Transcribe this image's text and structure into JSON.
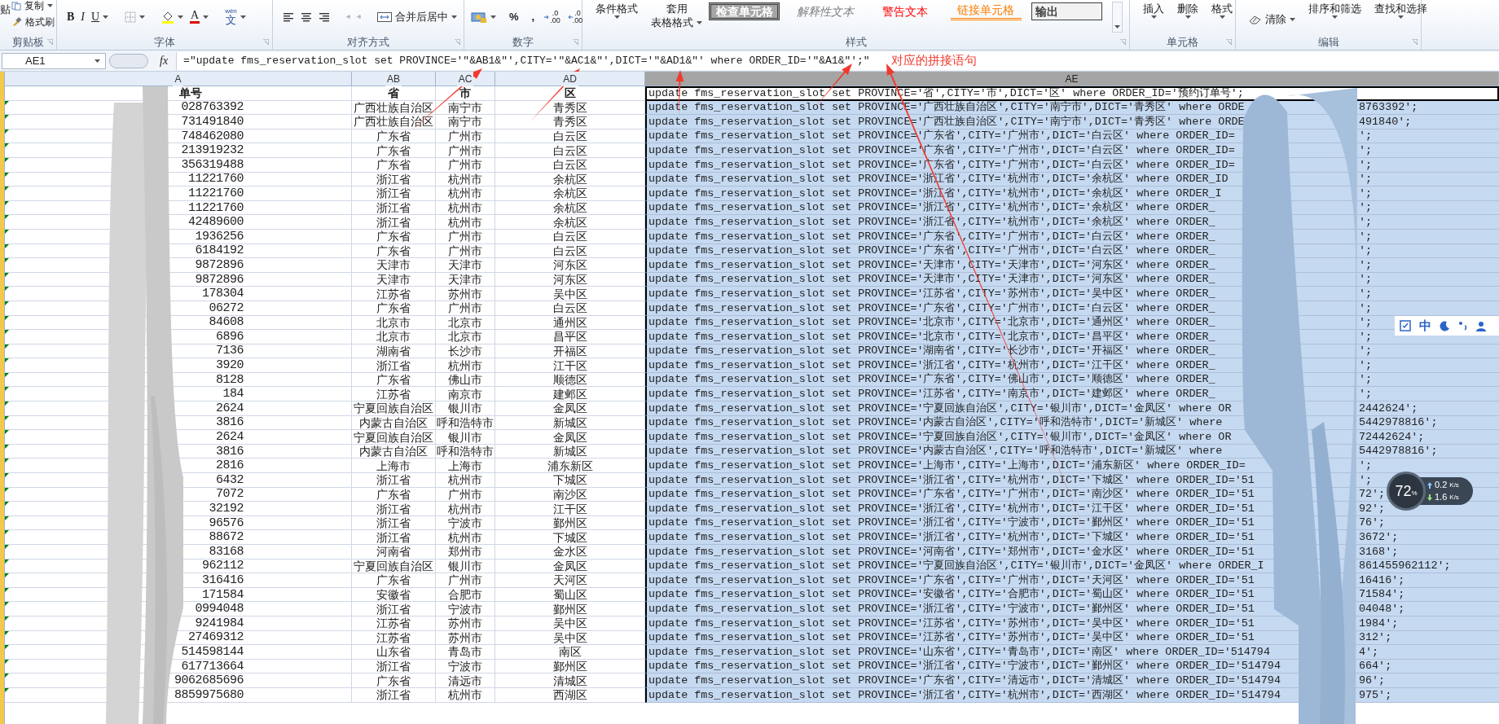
{
  "ribbon": {
    "groups": [
      {
        "label": "剪贴板",
        "items": [
          {
            "kind": "paste",
            "text": "贴"
          },
          {
            "kind": "copy",
            "text": "复制"
          },
          {
            "kind": "brush",
            "text": "格式刷"
          }
        ]
      },
      {
        "label": "字体",
        "items": [
          {
            "kind": "bold",
            "text": "B"
          },
          {
            "kind": "italic",
            "text": "I"
          },
          {
            "kind": "underline",
            "text": "U"
          },
          {
            "kind": "border"
          },
          {
            "kind": "fill"
          },
          {
            "kind": "fontcolor",
            "text": "A"
          },
          {
            "kind": "phonetic",
            "text": "文",
            "sup": "wén"
          }
        ]
      },
      {
        "label": "对齐方式",
        "items": [
          {
            "kind": "alignleft"
          },
          {
            "kind": "aligncenter"
          },
          {
            "kind": "alignright"
          },
          {
            "kind": "outdent"
          },
          {
            "kind": "indent"
          },
          {
            "kind": "merge",
            "text": "合并后居中"
          }
        ]
      },
      {
        "label": "数字",
        "items": [
          {
            "kind": "currency"
          },
          {
            "kind": "plain",
            "text": "%"
          },
          {
            "kind": "plain",
            "text": ","
          },
          {
            "kind": "decinc",
            "text": ".00",
            "sup": ".0"
          },
          {
            "kind": "decdec",
            "text": ".00",
            "sup": ".0"
          }
        ]
      },
      {
        "label": "样式",
        "items": [
          {
            "kind": "stacked",
            "text": "条件格式"
          },
          {
            "kind": "stacked",
            "text": "套用",
            "sub": "表格格式"
          },
          {
            "kind": "check",
            "text": "检查单元格"
          },
          {
            "kind": "explain",
            "text": "解释性文本"
          },
          {
            "kind": "warn",
            "text": "警告文本"
          },
          {
            "kind": "link",
            "text": "链接单元格"
          },
          {
            "kind": "output",
            "text": "输出"
          },
          {
            "kind": "gallery"
          }
        ]
      },
      {
        "label": "单元格",
        "items": [
          {
            "kind": "stacked",
            "text": "插入"
          },
          {
            "kind": "stacked",
            "text": "删除"
          },
          {
            "kind": "stacked",
            "text": "格式"
          }
        ]
      },
      {
        "label": "编辑",
        "items": [
          {
            "kind": "clear",
            "text": "清除"
          },
          {
            "kind": "stacked",
            "text": "排序和筛选"
          },
          {
            "kind": "stacked",
            "text": "查找和选择"
          }
        ]
      }
    ]
  },
  "name_box": "AE1",
  "fx": "fx",
  "formula": "=\"update fms_reservation_slot set PROVINCE='\"&AB1&\"',CITY='\"&AC1&\"',DICT='\"&AD1&\"' where ORDER_ID='\"&A1&\"';\"",
  "annotation": "对应的拼接语句",
  "columns": [
    "A",
    "AB",
    "AC",
    "AD",
    "AE"
  ],
  "header": {
    "a": "单号",
    "province": "省",
    "city": "市",
    "district": "区",
    "sql": "update fms_reservation_slot set PROVINCE='省',CITY='市',DICT='区' where ORDER_ID='预约订单号';"
  },
  "rows": [
    {
      "order": "028763392",
      "province": "广西壮族自治区",
      "city": "南宁市",
      "district": "青秀区",
      "sql": "update fms_reservation_slot set PROVINCE='广西壮族自治区',CITY='南宁市',DICT='青秀区' where ORDE",
      "tail": "8763392';"
    },
    {
      "order": "731491840",
      "province": "广西壮族自治区",
      "city": "南宁市",
      "district": "青秀区",
      "sql": "update fms_reservation_slot set PROVINCE='广西壮族自治区',CITY='南宁市',DICT='青秀区' where ORDE",
      "tail": "491840';"
    },
    {
      "order": "748462080",
      "province": "广东省",
      "city": "广州市",
      "district": "白云区",
      "sql": "update fms_reservation_slot set PROVINCE='广东省',CITY='广州市',DICT='白云区' where ORDER_ID=",
      "tail": "';"
    },
    {
      "order": "213919232",
      "province": "广东省",
      "city": "广州市",
      "district": "白云区",
      "sql": "update fms_reservation_slot set PROVINCE='广东省',CITY='广州市',DICT='白云区' where ORDER_ID=",
      "tail": "';"
    },
    {
      "order": "356319488",
      "province": "广东省",
      "city": "广州市",
      "district": "白云区",
      "sql": "update fms_reservation_slot set PROVINCE='广东省',CITY='广州市',DICT='白云区' where ORDER_ID=",
      "tail": "';"
    },
    {
      "order": "11221760",
      "province": "浙江省",
      "city": "杭州市",
      "district": "余杭区",
      "sql": "update fms_reservation_slot set PROVINCE='浙江省',CITY='杭州市',DICT='余杭区' where ORDER_ID",
      "tail": "';"
    },
    {
      "order": "11221760",
      "province": "浙江省",
      "city": "杭州市",
      "district": "余杭区",
      "sql": "update fms_reservation_slot set PROVINCE='浙江省',CITY='杭州市',DICT='余杭区' where ORDER_I",
      "tail": "';"
    },
    {
      "order": "11221760",
      "province": "浙江省",
      "city": "杭州市",
      "district": "余杭区",
      "sql": "update fms_reservation_slot set PROVINCE='浙江省',CITY='杭州市',DICT='余杭区' where ORDER_",
      "tail": "';"
    },
    {
      "order": "42489600",
      "province": "浙江省",
      "city": "杭州市",
      "district": "余杭区",
      "sql": "update fms_reservation_slot set PROVINCE='浙江省',CITY='杭州市',DICT='余杭区' where ORDER_",
      "tail": "';"
    },
    {
      "order": "1936256",
      "province": "广东省",
      "city": "广州市",
      "district": "白云区",
      "sql": "update fms_reservation_slot set PROVINCE='广东省',CITY='广州市',DICT='白云区' where ORDER_",
      "tail": "';"
    },
    {
      "order": "6184192",
      "province": "广东省",
      "city": "广州市",
      "district": "白云区",
      "sql": "update fms_reservation_slot set PROVINCE='广东省',CITY='广州市',DICT='白云区' where ORDER_",
      "tail": "';"
    },
    {
      "order": "9872896",
      "province": "天津市",
      "city": "天津市",
      "district": "河东区",
      "sql": "update fms_reservation_slot set PROVINCE='天津市',CITY='天津市',DICT='河东区' where ORDER_",
      "tail": "';"
    },
    {
      "order": "9872896",
      "province": "天津市",
      "city": "天津市",
      "district": "河东区",
      "sql": "update fms_reservation_slot set PROVINCE='天津市',CITY='天津市',DICT='河东区' where ORDER_",
      "tail": "';"
    },
    {
      "order": "178304",
      "province": "江苏省",
      "city": "苏州市",
      "district": "吴中区",
      "sql": "update fms_reservation_slot set PROVINCE='江苏省',CITY='苏州市',DICT='吴中区' where ORDER_",
      "tail": "';"
    },
    {
      "order": "06272",
      "province": "广东省",
      "city": "广州市",
      "district": "白云区",
      "sql": "update fms_reservation_slot set PROVINCE='广东省',CITY='广州市',DICT='白云区' where ORDER_",
      "tail": "';"
    },
    {
      "order": "84608",
      "province": "北京市",
      "city": "北京市",
      "district": "通州区",
      "sql": "update fms_reservation_slot set PROVINCE='北京市',CITY='北京市',DICT='通州区' where ORDER_",
      "tail": "';"
    },
    {
      "order": "6896",
      "province": "北京市",
      "city": "北京市",
      "district": "昌平区",
      "sql": "update fms_reservation_slot set PROVINCE='北京市',CITY='北京市',DICT='昌平区' where ORDER_",
      "tail": "';"
    },
    {
      "order": "7136",
      "province": "湖南省",
      "city": "长沙市",
      "district": "开福区",
      "sql": "update fms_reservation_slot set PROVINCE='湖南省',CITY='长沙市',DICT='开福区' where ORDER_",
      "tail": "';"
    },
    {
      "order": "3920",
      "province": "浙江省",
      "city": "杭州市",
      "district": "江干区",
      "sql": "update fms_reservation_slot set PROVINCE='浙江省',CITY='杭州市',DICT='江干区' where ORDER_",
      "tail": "';"
    },
    {
      "order": "8128",
      "province": "广东省",
      "city": "佛山市",
      "district": "顺德区",
      "sql": "update fms_reservation_slot set PROVINCE='广东省',CITY='佛山市',DICT='顺德区' where ORDER_",
      "tail": "';"
    },
    {
      "order": "184",
      "province": "江苏省",
      "city": "南京市",
      "district": "建邺区",
      "sql": "update fms_reservation_slot set PROVINCE='江苏省',CITY='南京市',DICT='建邺区' where ORDER_",
      "tail": "';"
    },
    {
      "order": "2624",
      "province": "宁夏回族自治区",
      "city": "银川市",
      "district": "金凤区",
      "sql": "update fms_reservation_slot set PROVINCE='宁夏回族自治区',CITY='银川市',DICT='金凤区' where OR",
      "tail": "2442624';"
    },
    {
      "order": "3816",
      "province": "内蒙古自治区",
      "city": "呼和浩特市",
      "district": "新城区",
      "sql": "update fms_reservation_slot set PROVINCE='内蒙古自治区',CITY='呼和浩特市',DICT='新城区' where",
      "tail": "5442978816';"
    },
    {
      "order": "2624",
      "province": "宁夏回族自治区",
      "city": "银川市",
      "district": "金凤区",
      "sql": "update fms_reservation_slot set PROVINCE='宁夏回族自治区',CITY='银川市',DICT='金凤区' where OR",
      "tail": "72442624';"
    },
    {
      "order": "3816",
      "province": "内蒙古自治区",
      "city": "呼和浩特市",
      "district": "新城区",
      "sql": "update fms_reservation_slot set PROVINCE='内蒙古自治区',CITY='呼和浩特市',DICT='新城区' where",
      "tail": "5442978816';"
    },
    {
      "order": "2816",
      "province": "上海市",
      "city": "上海市",
      "district": "浦东新区",
      "sql": "update fms_reservation_slot set PROVINCE='上海市',CITY='上海市',DICT='浦东新区' where ORDER_ID=",
      "tail": "';"
    },
    {
      "order": "6432",
      "province": "浙江省",
      "city": "杭州市",
      "district": "下城区",
      "sql": "update fms_reservation_slot set PROVINCE='浙江省',CITY='杭州市',DICT='下城区' where ORDER_ID='51",
      "tail": "';"
    },
    {
      "order": "7072",
      "province": "广东省",
      "city": "广州市",
      "district": "南沙区",
      "sql": "update fms_reservation_slot set PROVINCE='广东省',CITY='广州市',DICT='南沙区' where ORDER_ID='51",
      "tail": "72';"
    },
    {
      "order": "32192",
      "province": "浙江省",
      "city": "杭州市",
      "district": "江干区",
      "sql": "update fms_reservation_slot set PROVINCE='浙江省',CITY='杭州市',DICT='江干区' where ORDER_ID='51",
      "tail": "92';"
    },
    {
      "order": "96576",
      "province": "浙江省",
      "city": "宁波市",
      "district": "鄞州区",
      "sql": "update fms_reservation_slot set PROVINCE='浙江省',CITY='宁波市',DICT='鄞州区' where ORDER_ID='51",
      "tail": "76';"
    },
    {
      "order": "88672",
      "province": "浙江省",
      "city": "杭州市",
      "district": "下城区",
      "sql": "update fms_reservation_slot set PROVINCE='浙江省',CITY='杭州市',DICT='下城区' where ORDER_ID='51",
      "tail": "3672';"
    },
    {
      "order": "83168",
      "province": "河南省",
      "city": "郑州市",
      "district": "金水区",
      "sql": "update fms_reservation_slot set PROVINCE='河南省',CITY='郑州市',DICT='金水区' where ORDER_ID='51",
      "tail": "3168';"
    },
    {
      "order": "962112",
      "province": "宁夏回族自治区",
      "city": "银川市",
      "district": "金凤区",
      "sql": "update fms_reservation_slot set PROVINCE='宁夏回族自治区',CITY='银川市',DICT='金凤区' where ORDER_I",
      "tail": "861455962112';"
    },
    {
      "order": "316416",
      "province": "广东省",
      "city": "广州市",
      "district": "天河区",
      "sql": "update fms_reservation_slot set PROVINCE='广东省',CITY='广州市',DICT='天河区' where ORDER_ID='51",
      "tail": "16416';"
    },
    {
      "order": "171584",
      "province": "安徽省",
      "city": "合肥市",
      "district": "蜀山区",
      "sql": "update fms_reservation_slot set PROVINCE='安徽省',CITY='合肥市',DICT='蜀山区' where ORDER_ID='51",
      "tail": "71584';"
    },
    {
      "order": "0994048",
      "province": "浙江省",
      "city": "宁波市",
      "district": "鄞州区",
      "sql": "update fms_reservation_slot set PROVINCE='浙江省',CITY='宁波市',DICT='鄞州区' where ORDER_ID='51",
      "tail": "04048';"
    },
    {
      "order": "9241984",
      "province": "江苏省",
      "city": "苏州市",
      "district": "吴中区",
      "sql": "update fms_reservation_slot set PROVINCE='江苏省',CITY='苏州市',DICT='吴中区' where ORDER_ID='51",
      "tail": "1984';"
    },
    {
      "order": "27469312",
      "province": "江苏省",
      "city": "苏州市",
      "district": "吴中区",
      "sql": "update fms_reservation_slot set PROVINCE='江苏省',CITY='苏州市',DICT='吴中区' where ORDER_ID='51",
      "tail": "312';"
    },
    {
      "order": "514598144",
      "province": "山东省",
      "city": "青岛市",
      "district": "南区",
      "sql": "update fms_reservation_slot set PROVINCE='山东省',CITY='青岛市',DICT='南区' where ORDER_ID='514794",
      "tail": "4';"
    },
    {
      "order": "617713664",
      "province": "浙江省",
      "city": "宁波市",
      "district": "鄞州区",
      "sql": "update fms_reservation_slot set PROVINCE='浙江省',CITY='宁波市',DICT='鄞州区' where ORDER_ID='514794",
      "tail": "664';"
    },
    {
      "order": "9062685696",
      "province": "广东省",
      "city": "清远市",
      "district": "清城区",
      "sql": "update fms_reservation_slot set PROVINCE='广东省',CITY='清远市',DICT='清城区' where ORDER_ID='514794",
      "tail": "96';"
    },
    {
      "order": "8859975680",
      "province": "浙江省",
      "city": "杭州市",
      "district": "西湖区",
      "sql": "update fms_reservation_slot set PROVINCE='浙江省',CITY='杭州市',DICT='西湖区' where ORDER_ID='514794",
      "tail": "975';"
    }
  ],
  "ime_bar": {
    "text": "中"
  },
  "net_widget": {
    "percent": "72",
    "percent_unit": "%",
    "up": "0.2",
    "up_unit": "K/s",
    "down": "1.6",
    "down_unit": "K/s"
  }
}
